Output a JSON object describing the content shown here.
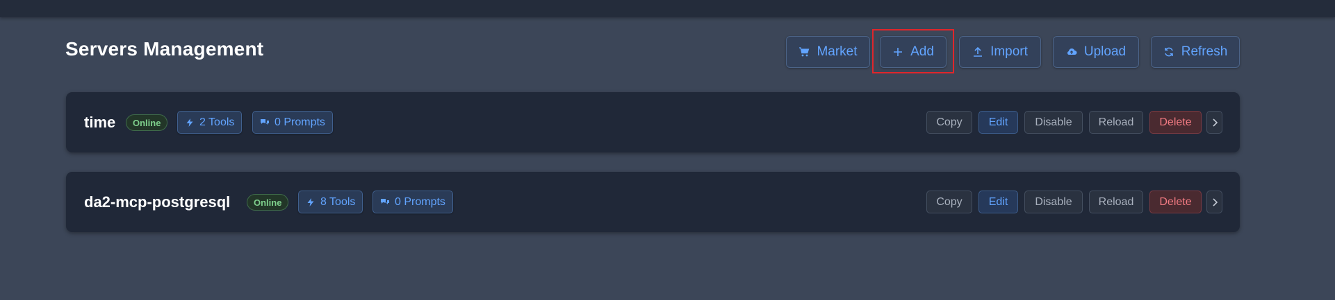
{
  "page": {
    "title": "Servers Management"
  },
  "toolbar": {
    "market_label": "Market",
    "add_label": "Add",
    "import_label": "Import",
    "upload_label": "Upload",
    "refresh_label": "Refresh"
  },
  "servers": [
    {
      "name": "time",
      "status": "Online",
      "tools": "2 Tools",
      "prompts": "0 Prompts",
      "actions": {
        "copy": "Copy",
        "edit": "Edit",
        "disable": "Disable",
        "reload": "Reload",
        "delete": "Delete"
      }
    },
    {
      "name": "da2-mcp-postgresql",
      "status": "Online",
      "tools": "8 Tools",
      "prompts": "0 Prompts",
      "actions": {
        "copy": "Copy",
        "edit": "Edit",
        "disable": "Disable",
        "reload": "Reload",
        "delete": "Delete"
      }
    }
  ],
  "colors": {
    "background": "#3c4658",
    "card": "#202838",
    "accent": "#62a4ff",
    "online": "#7ecf8c",
    "danger": "#f27a82",
    "highlight": "#e0262b"
  },
  "icons": {
    "market": "cart-icon",
    "add": "plus-icon",
    "import": "upload-arrow-icon",
    "upload": "cloud-upload-icon",
    "refresh": "refresh-icon",
    "tools": "lightning-icon",
    "prompts": "chat-bubbles-icon",
    "expand": "chevron-right-icon"
  }
}
